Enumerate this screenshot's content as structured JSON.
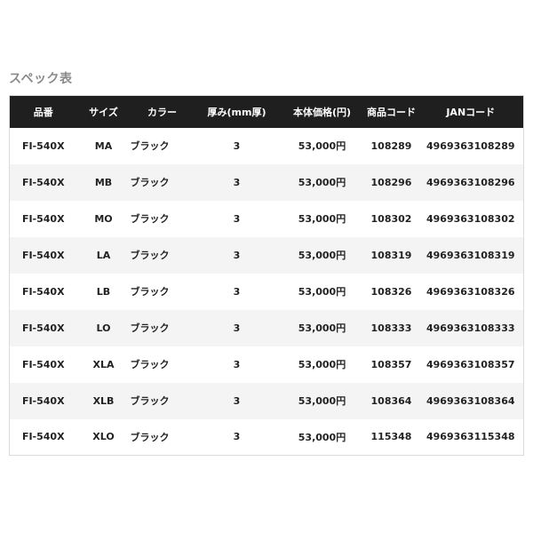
{
  "section": {
    "title": "スペック表"
  },
  "table": {
    "headers": [
      "品番",
      "サイズ",
      "カラー",
      "厚み(mm厚)",
      "本体価格(円)",
      "商品コード",
      "JANコード"
    ],
    "rows": [
      [
        "FI-540X",
        "MA",
        "ブラック",
        "3",
        "53,000円",
        "108289",
        "4969363108289"
      ],
      [
        "FI-540X",
        "MB",
        "ブラック",
        "3",
        "53,000円",
        "108296",
        "4969363108296"
      ],
      [
        "FI-540X",
        "MO",
        "ブラック",
        "3",
        "53,000円",
        "108302",
        "4969363108302"
      ],
      [
        "FI-540X",
        "LA",
        "ブラック",
        "3",
        "53,000円",
        "108319",
        "4969363108319"
      ],
      [
        "FI-540X",
        "LB",
        "ブラック",
        "3",
        "53,000円",
        "108326",
        "4969363108326"
      ],
      [
        "FI-540X",
        "LO",
        "ブラック",
        "3",
        "53,000円",
        "108333",
        "4969363108333"
      ],
      [
        "FI-540X",
        "XLA",
        "ブラック",
        "3",
        "53,000円",
        "108357",
        "4969363108357"
      ],
      [
        "FI-540X",
        "XLB",
        "ブラック",
        "3",
        "53,000円",
        "108364",
        "4969363108364"
      ],
      [
        "FI-540X",
        "XLO",
        "ブラック",
        "3",
        "53,000円",
        "115348",
        "4969363115348"
      ]
    ]
  },
  "colors": {
    "header_bg": "#1f1f1f",
    "header_text": "#ffffff",
    "row_alt_bg": "#f4f4f4",
    "title_text": "#8a8a8a"
  }
}
